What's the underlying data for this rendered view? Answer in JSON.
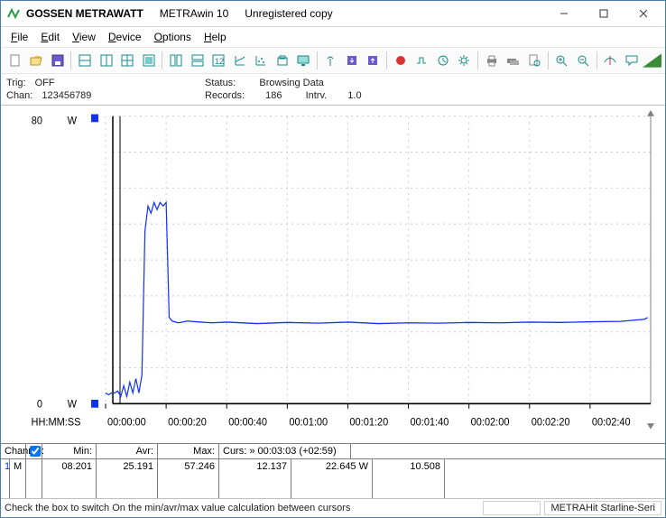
{
  "title": {
    "brand": "GOSSEN METRAWATT",
    "app": "METRAwin 10",
    "state": "Unregistered copy"
  },
  "menu": {
    "file": "File",
    "edit": "Edit",
    "view": "View",
    "device": "Device",
    "options": "Options",
    "help": "Help"
  },
  "info": {
    "trig_label": "Trig:",
    "trig_value": "OFF",
    "chan_label": "Chan:",
    "chan_value": "123456789",
    "status_label": "Status:",
    "status_value": "Browsing Data",
    "records_label": "Records:",
    "records_value": "186",
    "intrv_label": "Intrv.",
    "intrv_value": "1.0"
  },
  "axis": {
    "y_top": "80",
    "y_bot": "0",
    "y_unit": "W",
    "x_unit": "HH:MM:SS",
    "ticks": [
      "00:00:00",
      "00:00:20",
      "00:00:40",
      "00:01:00",
      "00:01:20",
      "00:01:40",
      "00:02:00",
      "00:02:20",
      "00:02:40"
    ]
  },
  "tablehdr": {
    "channel": "Channel:",
    "min": "Min:",
    "avr": "Avr:",
    "max": "Max:",
    "curs": "Curs: » 00:03:03 (+02:59)"
  },
  "row": {
    "idx": "1",
    "dev": "M",
    "min": "08.201",
    "avr": "25.191",
    "max": "57.246",
    "a": "12.137",
    "b": "22.645  W",
    "c": "10.508"
  },
  "status": {
    "msg": "Check the box to switch On the min/avr/max value calculation between cursors",
    "dev": "METRAHit Starline-Seri"
  },
  "chart_data": {
    "type": "line",
    "title": "",
    "xlabel": "HH:MM:SS",
    "ylabel": "W",
    "xlim": [
      0,
      180
    ],
    "ylim": [
      0,
      80
    ],
    "x_ticks": [
      0,
      20,
      40,
      60,
      80,
      100,
      120,
      140,
      160
    ],
    "series": [
      {
        "name": "Channel 1 M",
        "color": "#1030ff",
        "x": [
          0,
          1,
          2,
          3,
          4,
          5,
          6,
          7,
          8,
          9,
          10,
          11,
          12,
          13,
          14,
          15,
          16,
          17,
          18,
          19,
          20,
          21,
          22,
          24,
          27,
          30,
          35,
          40,
          50,
          60,
          70,
          80,
          90,
          100,
          110,
          120,
          130,
          140,
          150,
          160,
          170,
          178,
          179
        ],
        "values": [
          3,
          2.5,
          3,
          3,
          3.5,
          2,
          5,
          2,
          6,
          3,
          7,
          3,
          8,
          48,
          55,
          53,
          56,
          54,
          56,
          55,
          56,
          24,
          23,
          22.5,
          23,
          22.8,
          22.5,
          22.7,
          22.3,
          22.6,
          22.4,
          22.7,
          22.3,
          22.5,
          22.4,
          22.6,
          22.5,
          22.7,
          22.6,
          22.8,
          22.9,
          23.5,
          24
        ]
      }
    ]
  }
}
